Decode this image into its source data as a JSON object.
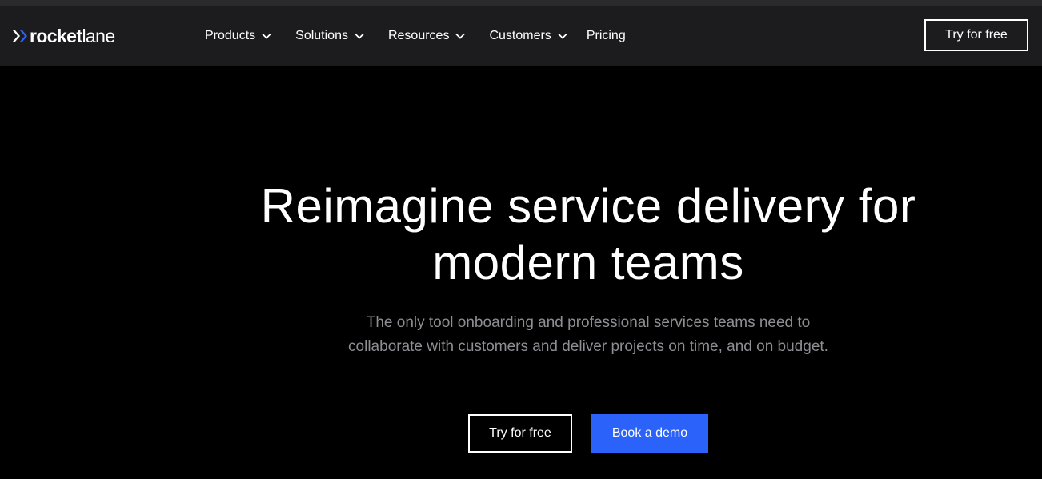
{
  "header": {
    "logo": {
      "icon": "double-chevron-right-icon",
      "text_bold": "rocket",
      "text_light": "lane",
      "accent_color": "#2b62fa"
    },
    "nav": [
      {
        "label": "Products",
        "has_dropdown": true,
        "icon": "chevron-down-icon"
      },
      {
        "label": "Solutions",
        "has_dropdown": true,
        "icon": "chevron-down-icon"
      },
      {
        "label": "Resources",
        "has_dropdown": true,
        "icon": "chevron-down-icon"
      },
      {
        "label": "Customers",
        "has_dropdown": true,
        "icon": "chevron-down-icon"
      },
      {
        "label": "Pricing",
        "has_dropdown": false
      }
    ],
    "cta_label": "Try for free"
  },
  "hero": {
    "title_line1": "Reimagine service delivery for",
    "title_line2": "modern teams",
    "subtitle": "The only tool onboarding and professional services teams need to collaborate with customers and deliver projects on time, and on budget.",
    "primary_cta": "Book a demo",
    "secondary_cta": "Try for free"
  },
  "colors": {
    "background": "#000000",
    "navbar": "#1c1c1e",
    "primary_button": "#2b62fa",
    "subtitle_text": "#8e8e93"
  }
}
